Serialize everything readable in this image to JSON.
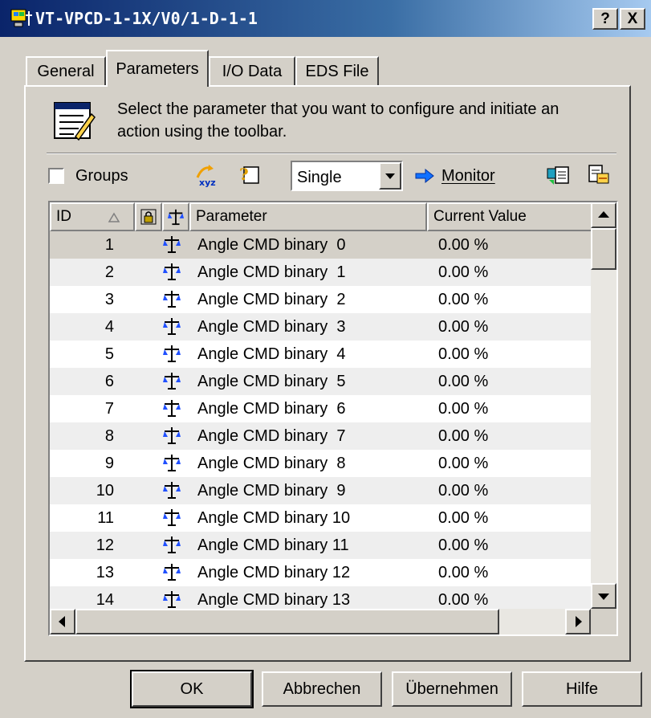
{
  "window": {
    "title": "VT-VPCD-1-1X/V0/1-D-1-1",
    "help_label": "?",
    "close_label": "X"
  },
  "tabs": [
    {
      "label": "General",
      "active": false
    },
    {
      "label": "Parameters",
      "active": true
    },
    {
      "label": "I/O Data",
      "active": false
    },
    {
      "label": "EDS File",
      "active": false
    }
  ],
  "header": {
    "instruction": "Select the parameter that you want to configure and initiate an action using the toolbar."
  },
  "toolbar": {
    "groups_label": "Groups",
    "groups_checked": false,
    "mode_value": "Single",
    "monitor_label": "Monitor"
  },
  "table": {
    "columns": [
      "ID",
      "Parameter",
      "Current Value"
    ],
    "rows": [
      {
        "id": "1",
        "parameter": "Angle CMD binary  0",
        "value": "0.00 %"
      },
      {
        "id": "2",
        "parameter": "Angle CMD binary  1",
        "value": "0.00 %"
      },
      {
        "id": "3",
        "parameter": "Angle CMD binary  2",
        "value": "0.00 %"
      },
      {
        "id": "4",
        "parameter": "Angle CMD binary  3",
        "value": "0.00 %"
      },
      {
        "id": "5",
        "parameter": "Angle CMD binary  4",
        "value": "0.00 %"
      },
      {
        "id": "6",
        "parameter": "Angle CMD binary  5",
        "value": "0.00 %"
      },
      {
        "id": "7",
        "parameter": "Angle CMD binary  6",
        "value": "0.00 %"
      },
      {
        "id": "8",
        "parameter": "Angle CMD binary  7",
        "value": "0.00 %"
      },
      {
        "id": "9",
        "parameter": "Angle CMD binary  8",
        "value": "0.00 %"
      },
      {
        "id": "10",
        "parameter": "Angle CMD binary  9",
        "value": "0.00 %"
      },
      {
        "id": "11",
        "parameter": "Angle CMD binary 10",
        "value": "0.00 %"
      },
      {
        "id": "12",
        "parameter": "Angle CMD binary 11",
        "value": "0.00 %"
      },
      {
        "id": "13",
        "parameter": "Angle CMD binary 12",
        "value": "0.00 %"
      },
      {
        "id": "14",
        "parameter": "Angle CMD binary 13",
        "value": "0.00 %"
      }
    ]
  },
  "buttons": {
    "ok": "OK",
    "cancel": "Abbrechen",
    "apply": "Übernehmen",
    "help": "Hilfe"
  },
  "colors": {
    "face": "#d4d0c8",
    "title_start": "#0a246a",
    "title_end": "#a6caf0",
    "row_alt": "#eeeeee",
    "row_selected": "#d4d0c8"
  }
}
